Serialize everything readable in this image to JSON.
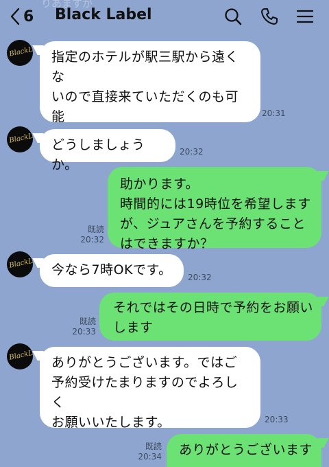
{
  "header": {
    "back_count": "6",
    "title": "Black Label"
  },
  "faded_top_text": "りあますが",
  "avatar_logo": "BlackLabel",
  "messages": [
    {
      "text": "指定のホテルが駅三駅から遠くな\nいので直接来ていただくのも可能\nです。",
      "time": "20:31"
    },
    {
      "text": "どうしましょうか。",
      "time": "20:32"
    },
    {
      "text": "助かります。\n時間的には19時位を希望します\nが、ジュアさんを予約すること\nはできますか？",
      "read": "既読",
      "time": "20:32"
    },
    {
      "text": "今なら7時OKです。",
      "time": "20:32"
    },
    {
      "text": "それではその日時で予約をお願い\nします",
      "read": "既読",
      "time": "20:33"
    },
    {
      "text": "ありがとうございます。ではご\n予約受けたまりますのでよろしく\nお願いいたします。",
      "time": "20:33"
    },
    {
      "text": "ありがとうございます",
      "read": "既読",
      "time": "20:34"
    }
  ]
}
